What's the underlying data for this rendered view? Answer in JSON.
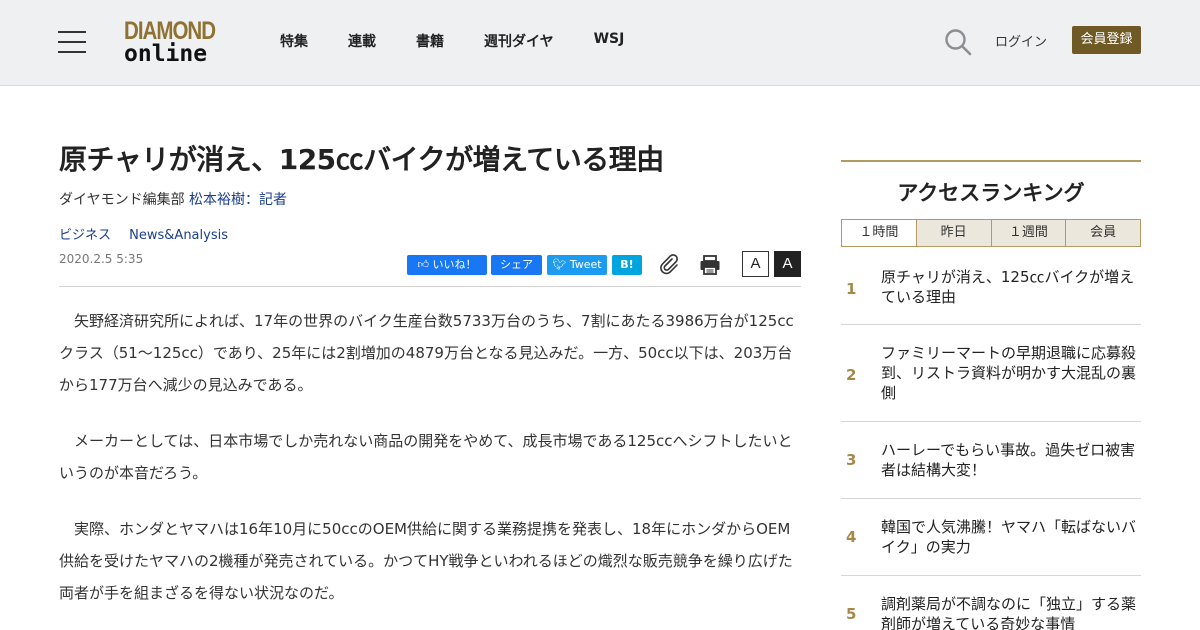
{
  "header": {
    "logo_top": "DIAMOND",
    "logo_bottom": "online",
    "nav": [
      "特集",
      "連載",
      "書籍",
      "週刊ダイヤ",
      "WSJ"
    ],
    "login_label": "ログイン",
    "register_label": "会員登録"
  },
  "article": {
    "title": "原チャリが消え、125㏄バイクが増えている理由",
    "byline_dept": "ダイヤモンド編集部",
    "byline_author": "松本裕樹：記者",
    "tags": [
      "ビジネス",
      "News&Analysis"
    ],
    "date": "2020.2.5 5:35",
    "share": {
      "fb_like": "いいね！",
      "fb_share": "シェア",
      "tweet": "Tweet",
      "hatena": "B!"
    },
    "font_size_labels": [
      "A",
      "A"
    ],
    "paragraphs": [
      "　矢野経済研究所によれば、17年の世界のバイク生産台数5733万台のうち、7割にあたる3986万台が125ccクラス（51～125cc）であり、25年には2割増加の4879万台となる見込みだ。一方、50cc以下は、203万台から177万台へ減少の見込みである。",
      "　メーカーとしては、日本市場でしか売れない商品の開発をやめて、成長市場である125ccへシフトしたいというのが本音だろう。",
      "　実際、ホンダとヤマハは16年10月に50ccのOEM供給に関する業務提携を発表し、18年にホンダからOEM供給を受けたヤマハの2機種が発売されている。かつてHY戦争といわれるほどの熾烈な販売競争を繰り広げた両者が手を組まざるを得ない状況なのだ。"
    ]
  },
  "sidebar": {
    "heading": "アクセスランキング",
    "tabs": [
      "１時間",
      "昨日",
      "１週間",
      "会員"
    ],
    "ranking": [
      {
        "rank": "1",
        "title": "原チャリが消え、125㏄バイクが増えている理由"
      },
      {
        "rank": "2",
        "title": "ファミリーマートの早期退職に応募殺到、リストラ資料が明かす大混乱の裏側"
      },
      {
        "rank": "3",
        "title": "ハーレーでもらい事故。過失ゼロ被害者は結構大変！"
      },
      {
        "rank": "4",
        "title": "韓国で人気沸騰！ヤマハ「転ばないバイク」の実力"
      },
      {
        "rank": "5",
        "title": "調剤薬局が不調なのに「独立」する薬剤師が増えている奇妙な事情"
      }
    ]
  },
  "colors": {
    "header_bg": "#eef0f2",
    "logo_gold": "#8f7131",
    "register_bg": "#6f5a25",
    "link_blue": "#1a3d8f",
    "rank_gold": "#a6884a",
    "facebook": "#1877f2",
    "twitter": "#1d9bf0",
    "hatena": "#00a4de"
  }
}
